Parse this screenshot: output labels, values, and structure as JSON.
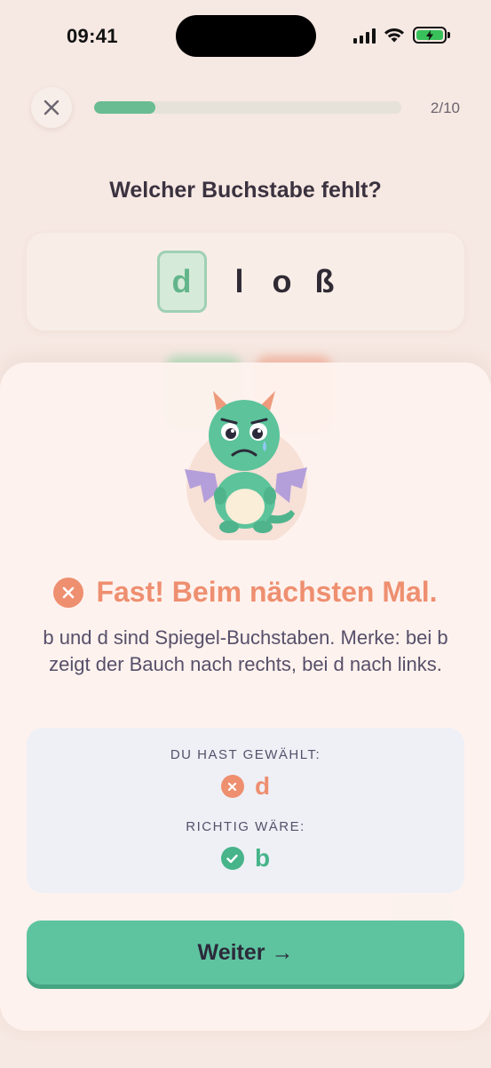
{
  "status_bar": {
    "time": "09:41",
    "battery_color": "#38c15a"
  },
  "quiz": {
    "close_icon": "close-icon",
    "progress": {
      "current": 2,
      "total": 10,
      "fraction": 0.2,
      "label": "2/10"
    },
    "question": "Welcher Buchstabe fehlt?",
    "word": {
      "missing_slot_value": "d",
      "letters": [
        "l",
        "o",
        "ß"
      ]
    }
  },
  "feedback": {
    "status": "incorrect",
    "title": "Fast! Beim nächsten Mal.",
    "explanation": "b und d sind Spiegel-Buchstaben. Merke: bei b zeigt der Bauch nach rechts, bei d nach links.",
    "chosen_label": "DU HAST GEWÄHLT:",
    "chosen_value": "d",
    "correct_label": "RICHTIG WÄRE:",
    "correct_value": "b",
    "continue_label": "Weiter →"
  },
  "colors": {
    "accent_green": "#5ec4a0",
    "error_orange": "#ee8f70",
    "text_dark": "#3c3346"
  }
}
